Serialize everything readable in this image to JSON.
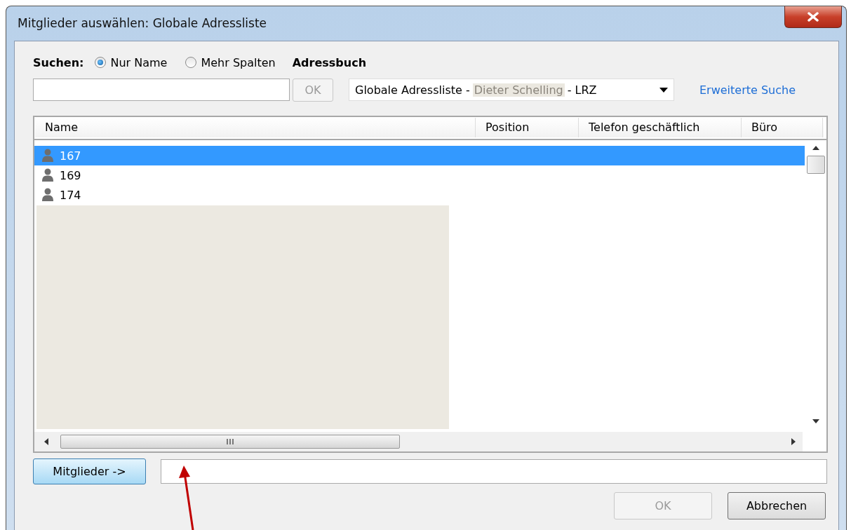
{
  "window": {
    "title": "Mitglieder auswählen: Globale Adressliste"
  },
  "search": {
    "label": "Suchen:",
    "options": [
      {
        "label": "Nur Name",
        "selected": true
      },
      {
        "label": "Mehr Spalten",
        "selected": false
      }
    ],
    "ok_button": {
      "label": "OK",
      "disabled": true
    }
  },
  "address_book": {
    "label": "Adressbuch",
    "value": "Globale Adressliste -",
    "redacted_text": "Dieter Schelling",
    "value_suffix": "- LRZ"
  },
  "advanced_search": "Erweiterte Suche",
  "table": {
    "columns": [
      "Name",
      "Position",
      "Telefon geschäftlich",
      "Büro"
    ],
    "rows": [
      {
        "name": "167",
        "selected": true
      },
      {
        "name": "169",
        "selected": false
      },
      {
        "name": "174",
        "selected": false
      }
    ]
  },
  "members_button": "Mitglieder ->",
  "buttons": [
    {
      "label": "OK",
      "disabled": true
    },
    {
      "label": "Abbrechen",
      "disabled": false
    }
  ]
}
